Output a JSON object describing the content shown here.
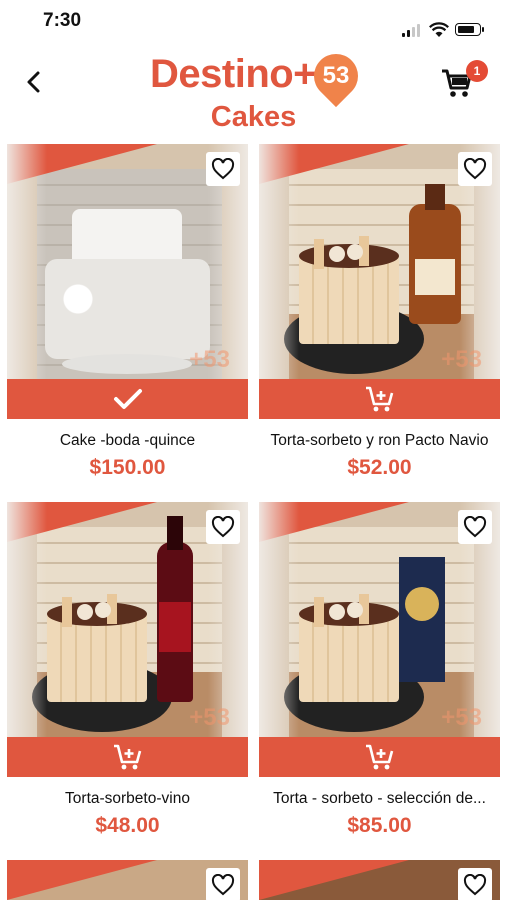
{
  "status_bar": {
    "time": "7:30"
  },
  "header": {
    "logo_text": "Destino+",
    "logo_number": "53",
    "category_title": "Cakes",
    "cart_count": "1"
  },
  "products": [
    {
      "name": "Cake -boda -quince",
      "price": "$150.00",
      "in_cart": true
    },
    {
      "name": "Torta-sorbeto y ron Pacto Navio",
      "price": "$52.00",
      "in_cart": false
    },
    {
      "name": "Torta-sorbeto-vino",
      "price": "$48.00",
      "in_cart": false
    },
    {
      "name": "Torta - sorbeto - selección de...",
      "price": "$85.00",
      "in_cart": false
    }
  ],
  "watermark": "+53",
  "colors": {
    "brand": "#e0573f",
    "accent": "#f0834a"
  }
}
